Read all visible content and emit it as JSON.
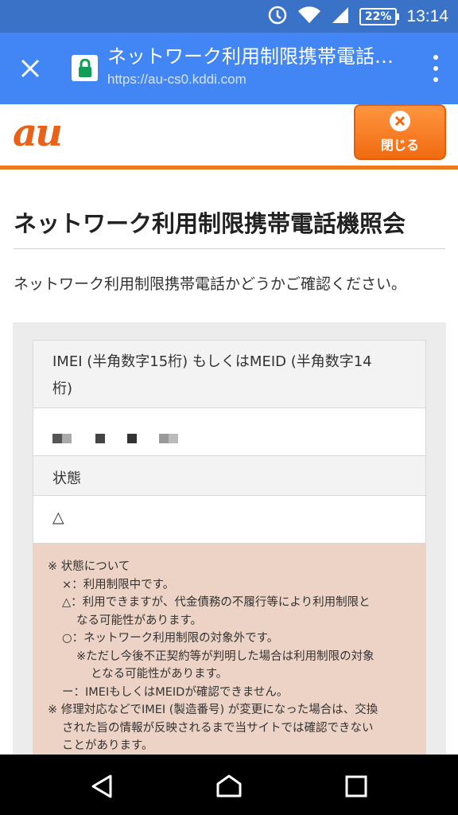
{
  "status_bar": {
    "battery": "22%",
    "time": "13:14",
    "icons": [
      "data-saver-icon",
      "wifi-icon",
      "signal-icon",
      "battery-icon"
    ]
  },
  "browser": {
    "title": "ネットワーク利用制限携帯電話機照会",
    "url": "https://au-cs0.kddi.com",
    "accent": "#4285f4"
  },
  "site": {
    "logo": "au",
    "close_button": "閉じる",
    "brand_color": "#f07a1b"
  },
  "page": {
    "heading": "ネットワーク利用制限携帯電話機照会",
    "lead": "ネットワーク利用制限携帯電話かどうかご確認ください。"
  },
  "result": {
    "imei_label_line1": "IMEI (半角数字15桁) もしくはMEID (半角数字14",
    "imei_label_line2": "桁)",
    "status_label": "状態",
    "status_value": "△"
  },
  "notes": [
    {
      "indent": 0,
      "text": "※ 状態について"
    },
    {
      "indent": 1,
      "text": "×：利用制限中です。"
    },
    {
      "indent": 1,
      "text": "△：利用できますが、代金債務の不履行等により利用制限と"
    },
    {
      "indent": 2,
      "text": "なる可能性があります。"
    },
    {
      "indent": 1,
      "text": "○：ネットワーク利用制限の対象外です。"
    },
    {
      "indent": 2,
      "text": "※ただし今後不正契約等が判明した場合は利用制限の対象"
    },
    {
      "indent": 3,
      "text": "となる可能性があります。"
    },
    {
      "indent": 1,
      "text": "ー：IMEIもしくはMEIDが確認できません。"
    },
    {
      "indent": 0,
      "text": "※ 修理対応などでIMEI (製造番号) が変更になった場合は、交換"
    },
    {
      "indent": 1,
      "text": "された旨の情報が反映されるまで当サイトでは確認できない"
    },
    {
      "indent": 1,
      "text": "ことがあります。"
    }
  ]
}
